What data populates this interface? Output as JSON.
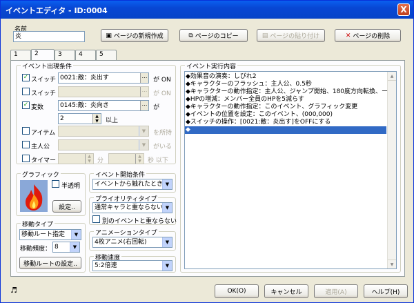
{
  "window": {
    "title": "イベントエディタ - ID:0004",
    "close_label": "X"
  },
  "name_box": {
    "legend": "名前",
    "value": "炎"
  },
  "toolbar": {
    "new_page": "ページの新規作成",
    "copy_page": "ページのコピー",
    "paste_page": "ページの貼り付け",
    "delete_page": "ページの削除"
  },
  "tabs": [
    "1",
    "2",
    "3",
    "4",
    "5"
  ],
  "conditions": {
    "legend": "イベント出現条件",
    "switch1": {
      "label": "スイッチ",
      "value": "0021:敵：炎出す",
      "suffix": "が ON",
      "checked": true
    },
    "switch2": {
      "label": "スイッチ",
      "value": "",
      "suffix": "が ON",
      "checked": false
    },
    "variable": {
      "label": "変数",
      "value": "0145:敵：炎向き",
      "suffix": "が",
      "number": "2",
      "compare": "以上",
      "checked": true
    },
    "item": {
      "label": "アイテム",
      "suffix": "を所持",
      "checked": false
    },
    "actor": {
      "label": "主人公",
      "suffix": "がいる",
      "checked": false
    },
    "timer": {
      "label": "タイマー",
      "min_unit": "分",
      "sec_unit": "秒 以下",
      "checked": false
    }
  },
  "graphic": {
    "legend": "グラフィック",
    "semi_transparent": "半透明",
    "settings_button": "設定.."
  },
  "trigger": {
    "legend": "イベント開始条件",
    "value": "イベントから触れたとき"
  },
  "priority": {
    "legend": "プライオリティタイプ",
    "value": "通常キャラと重ならない",
    "no_overlap": "別のイベントと重ならない"
  },
  "animation": {
    "legend": "アニメーションタイプ",
    "value": "4枚アニメ(右回転)"
  },
  "move_speed": {
    "legend": "移動速度",
    "value": "5:2倍速"
  },
  "movement": {
    "legend": "移動タイプ",
    "type_value": "移動ルート指定",
    "freq_label": "移動頻度：",
    "freq_value": "8",
    "route_button": "移動ルートの設定.."
  },
  "commands": {
    "legend": "イベント実行内容",
    "lines": [
      "◆効果音の演奏：しびれ2",
      "◆キャラクターのフラッシュ：主人公、0.5秒",
      "◆キャラクターの動作指定：主人公、ジャンプ開始、180度方向転換、ー",
      "◆HPの増減：メンバー全員のHPを5減らす",
      "◆キャラクターの動作指定：このイベント、グラフィック変更",
      "◆イベントの位置を設定：このイベント、(000,000)",
      "◆スイッチの操作：[0021:敵：炎出す]をOFFにする",
      "◆"
    ],
    "selected_index": 7
  },
  "footer": {
    "music_icon": "music-note-icon",
    "ok": "OK(O)",
    "cancel": "キャンセル",
    "apply": "適用(A)",
    "help": "ヘルプ(H)"
  }
}
